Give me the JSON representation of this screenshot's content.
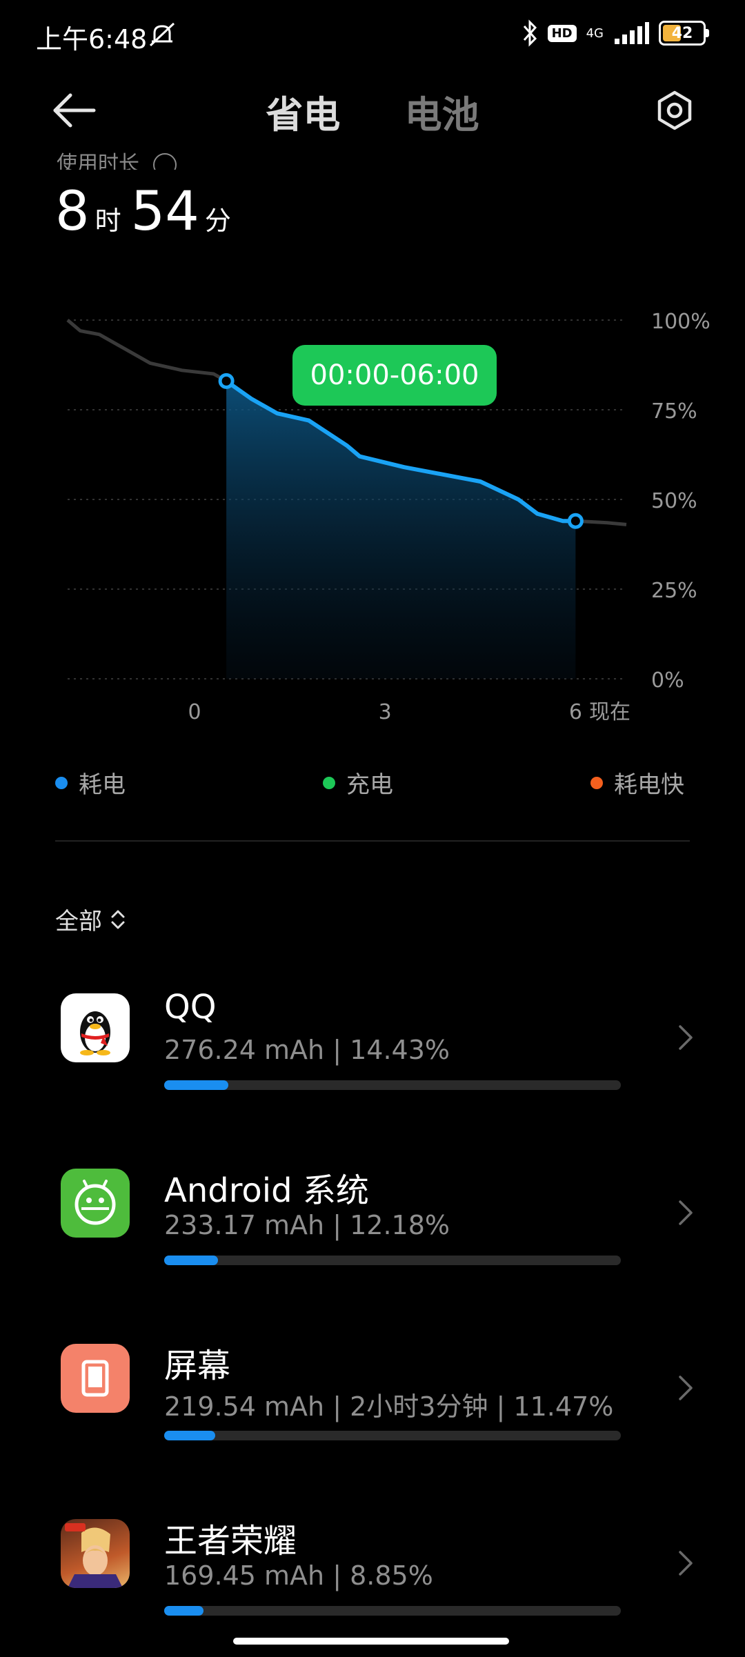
{
  "status_bar": {
    "time": "上午6:48",
    "hd": "HD",
    "network": "4G",
    "battery_percent": "42"
  },
  "header": {
    "tab_power_saving": "省电",
    "tab_battery": "电池"
  },
  "usage": {
    "label": "使用时长",
    "hours": "8",
    "hours_unit": "时",
    "minutes": "54",
    "minutes_unit": "分"
  },
  "chart_data": {
    "type": "area",
    "x_ticks": [
      "0",
      "3",
      "6",
      "现在"
    ],
    "y_ticks": [
      "100%",
      "75%",
      "50%",
      "25%",
      "0%"
    ],
    "ylim": [
      0,
      100
    ],
    "grid": true,
    "tooltip": "00:00-06:00",
    "selected_range": [
      0,
      6
    ],
    "series": [
      {
        "x": [
          -2,
          -1.8,
          -1.5,
          -1.2,
          -0.7,
          -0.2,
          0.3,
          0.5,
          0.9,
          1.3,
          1.8,
          2.4,
          2.6,
          3.3,
          4.2,
          4.5,
          5.1,
          5.4,
          5.8,
          6.0,
          6.5,
          6.8
        ],
        "y": [
          100,
          97,
          96,
          93,
          88,
          86,
          85,
          83,
          78,
          74,
          72,
          65,
          62,
          59,
          56,
          55,
          50,
          46,
          44,
          44,
          43.5,
          43
        ]
      }
    ],
    "colors": {
      "line_selected": "#1aa3f5",
      "line_other": "#3a3a3a",
      "grid": "#333333",
      "tick_label": "#9a9a9a"
    }
  },
  "legend": [
    {
      "label": "耗电",
      "color": "#1a8ef0"
    },
    {
      "label": "充电",
      "color": "#1dc857"
    },
    {
      "label": "耗电快",
      "color": "#f5601e"
    }
  ],
  "filter": {
    "label": "全部",
    "icon": "updown-chevron-icon"
  },
  "apps": [
    {
      "name": "QQ",
      "detail": "276.24 mAh | 14.43%",
      "percent": 14.43,
      "icon": "qq-penguin-icon"
    },
    {
      "name": "Android 系统",
      "detail": "233.17 mAh | 12.18%",
      "percent": 12.18,
      "icon": "android-system-icon"
    },
    {
      "name": "屏幕",
      "detail": "219.54 mAh | 2小时3分钟 | 11.47%",
      "percent": 11.47,
      "icon": "screen-icon"
    },
    {
      "name": "王者荣耀",
      "detail": "169.45 mAh | 8.85%",
      "percent": 8.85,
      "icon": "honor-of-kings-icon"
    }
  ]
}
